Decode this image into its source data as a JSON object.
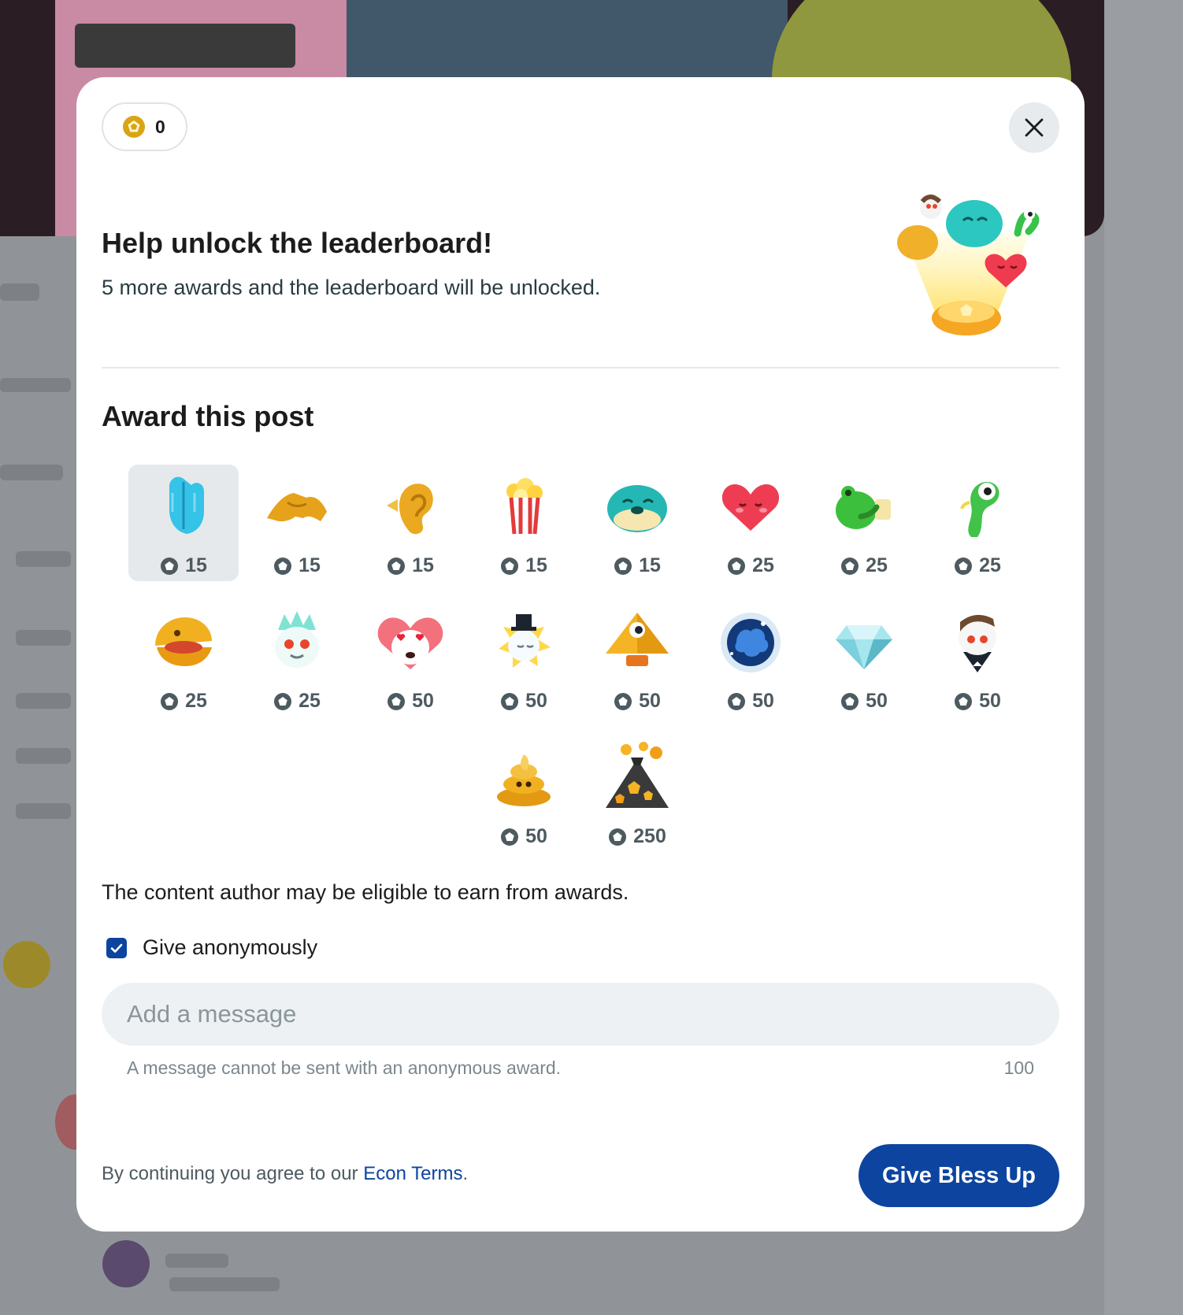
{
  "balance": {
    "value": "0",
    "icon": "gold-coin-icon"
  },
  "close": {
    "icon": "close-icon"
  },
  "leaderboard": {
    "title": "Help unlock the leaderboard!",
    "subtitle": "5 more awards and the leaderboard will be unlocked.",
    "art": "leaderboard-awards-art"
  },
  "award_section": {
    "title": "Award this post"
  },
  "awards": [
    {
      "icon": "praying-hands-icon",
      "price": "15",
      "selected": true
    },
    {
      "icon": "pinky-promise-icon",
      "price": "15"
    },
    {
      "icon": "golden-ear-icon",
      "price": "15"
    },
    {
      "icon": "popcorn-icon",
      "price": "15"
    },
    {
      "icon": "seal-icon",
      "price": "15"
    },
    {
      "icon": "heart-icon",
      "price": "25"
    },
    {
      "icon": "frog-drinking-icon",
      "price": "25"
    },
    {
      "icon": "snake-icon",
      "price": "25"
    },
    {
      "icon": "golden-clam-icon",
      "price": "25"
    },
    {
      "icon": "snoo-spiky-icon",
      "price": "25"
    },
    {
      "icon": "snoo-heart-eyes-icon",
      "price": "50"
    },
    {
      "icon": "top-hat-sun-icon",
      "price": "50"
    },
    {
      "icon": "pyramid-eye-icon",
      "price": "50"
    },
    {
      "icon": "galaxy-brain-icon",
      "price": "50"
    },
    {
      "icon": "diamond-icon",
      "price": "50"
    },
    {
      "icon": "snoo-tuxedo-icon",
      "price": "50"
    },
    {
      "icon": "golden-poop-icon",
      "price": "50"
    },
    {
      "icon": "volcano-icon",
      "price": "250"
    }
  ],
  "eligible_text": "The content author may be eligible to earn from awards.",
  "anonymous": {
    "label": "Give anonymously",
    "checked": true
  },
  "message": {
    "placeholder": "Add a message",
    "helper": "A message cannot be sent with an anonymous award.",
    "counter": "100"
  },
  "terms": {
    "prefix": "By continuing you agree to our ",
    "link": "Econ Terms",
    "suffix": "."
  },
  "submit_label": "Give Bless Up",
  "colors": {
    "primary": "#0c44a0",
    "coin": "#c7920a",
    "selected_bg": "#e6e9ec"
  }
}
